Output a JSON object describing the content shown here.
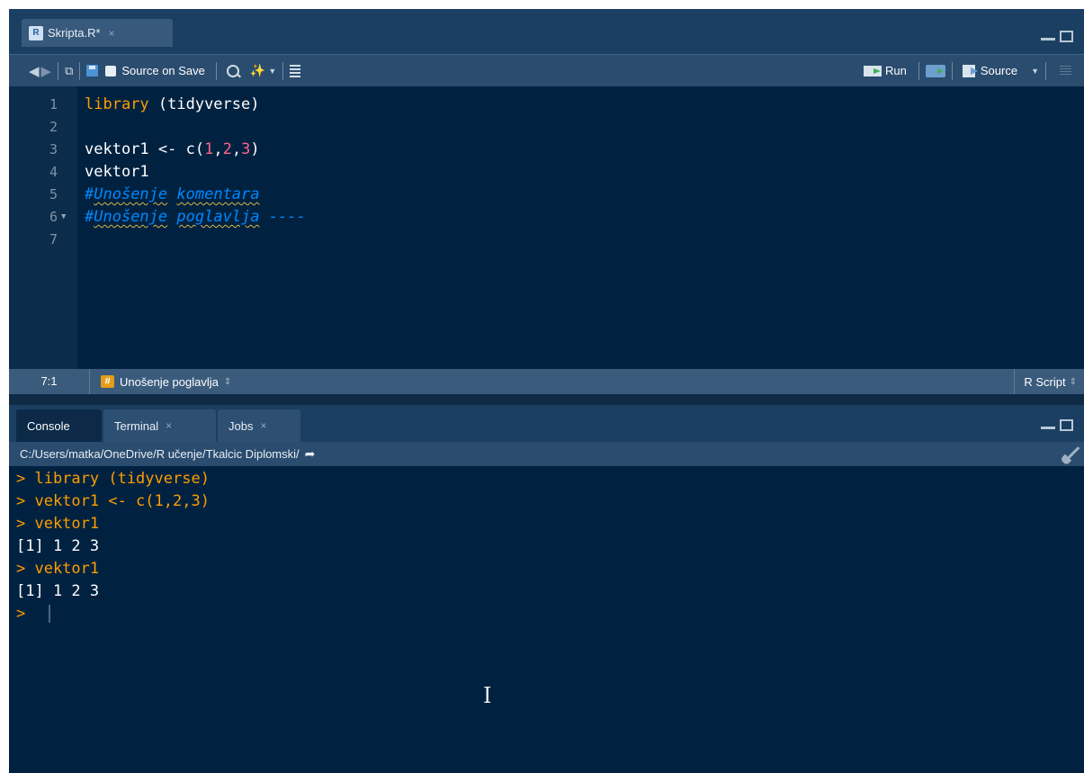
{
  "editor": {
    "tab": {
      "icon": "r-script-file-icon",
      "label": "Skripta.R*",
      "close": "×"
    },
    "toolbar": {
      "back": "back-arrow-icon",
      "forward": "forward-arrow-icon",
      "source_on_save_label": "Source on Save",
      "run_label": "Run",
      "source_label": "Source"
    },
    "lines": [
      {
        "num": "1",
        "tokens": [
          {
            "t": "library",
            "c": "tok-fn"
          },
          {
            "t": " (tidyverse)",
            "c": "tok-plain"
          }
        ]
      },
      {
        "num": "2",
        "tokens": []
      },
      {
        "num": "3",
        "tokens": [
          {
            "t": "vektor1 <- c(",
            "c": "tok-plain"
          },
          {
            "t": "1",
            "c": "tok-num"
          },
          {
            "t": ",",
            "c": "tok-plain"
          },
          {
            "t": "2",
            "c": "tok-num"
          },
          {
            "t": ",",
            "c": "tok-plain"
          },
          {
            "t": "3",
            "c": "tok-num"
          },
          {
            "t": ")",
            "c": "tok-plain"
          }
        ]
      },
      {
        "num": "4",
        "tokens": [
          {
            "t": "vektor1",
            "c": "tok-plain"
          }
        ]
      },
      {
        "num": "5",
        "tokens": [
          {
            "t": "#",
            "c": "tok-comment"
          },
          {
            "t": "Unošenje",
            "c": "tok-comment spell"
          },
          {
            "t": " ",
            "c": "tok-comment"
          },
          {
            "t": "komentara",
            "c": "tok-comment spell"
          }
        ]
      },
      {
        "num": "6",
        "fold": true,
        "tokens": [
          {
            "t": "#",
            "c": "tok-comment"
          },
          {
            "t": "Unošenje",
            "c": "tok-comment spell"
          },
          {
            "t": " ",
            "c": "tok-comment"
          },
          {
            "t": "poglavlja",
            "c": "tok-comment spell"
          },
          {
            "t": " ----",
            "c": "tok-comment"
          }
        ]
      },
      {
        "num": "7",
        "tokens": []
      }
    ],
    "status": {
      "cursor_position": "7:1",
      "chapter_icon": "#",
      "chapter": "Unošenje poglavlja",
      "file_type": "R Script"
    }
  },
  "console": {
    "tabs": [
      {
        "label": "Console",
        "active": true,
        "closable": false
      },
      {
        "label": "Terminal",
        "active": false,
        "closable": true
      },
      {
        "label": "Jobs",
        "active": false,
        "closable": true
      }
    ],
    "path": "C:/Users/matka/OneDrive/R učenje/Tkalcic Diplomski/",
    "lines": [
      {
        "text": "> library (tidyverse)",
        "type": "c-cmd"
      },
      {
        "text": "> vektor1 <- c(1,2,3)",
        "type": "c-cmd"
      },
      {
        "text": "> vektor1",
        "type": "c-cmd"
      },
      {
        "text": "[1] 1 2 3",
        "type": "c-out"
      },
      {
        "text": "> vektor1",
        "type": "c-cmd"
      },
      {
        "text": "[1] 1 2 3",
        "type": "c-out"
      },
      {
        "text": "> ",
        "type": "c-cmd"
      }
    ]
  },
  "icons": {
    "updown": "⇕",
    "close": "×"
  },
  "colors": {
    "editor_background": "#002240",
    "keyword": "#ff9d00",
    "number": "#ff628c",
    "comment": "#0088ff",
    "console_command": "#ff9d00"
  }
}
